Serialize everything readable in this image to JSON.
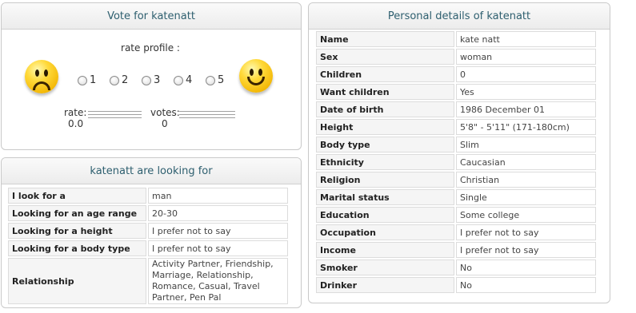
{
  "vote": {
    "title": "Vote for katenatt",
    "rate_profile": "rate profile :",
    "options": [
      "1",
      "2",
      "3",
      "4",
      "5"
    ],
    "rate_label": "rate:",
    "rate_value": "0.0",
    "votes_label": "votes:",
    "votes_value": "0"
  },
  "looking": {
    "title": "katenatt are looking for",
    "rows": [
      {
        "label": "I look for a",
        "value": "man"
      },
      {
        "label": "Looking for an age range",
        "value": "20-30"
      },
      {
        "label": "Looking for a height",
        "value": "I prefer not to say"
      },
      {
        "label": "Looking for a body type",
        "value": "I prefer not to say"
      },
      {
        "label": "Relationship",
        "value": "Activity Partner, Friendship, Marriage, Relationship, Romance, Casual, Travel Partner, Pen Pal"
      }
    ]
  },
  "details": {
    "title": "Personal details of katenatt",
    "rows": [
      {
        "label": "Name",
        "value": "kate natt"
      },
      {
        "label": "Sex",
        "value": "woman"
      },
      {
        "label": "Children",
        "value": "0"
      },
      {
        "label": "Want children",
        "value": "Yes"
      },
      {
        "label": "Date of birth",
        "value": "1986 December 01"
      },
      {
        "label": "Height",
        "value": "5'8\" - 5'11\" (171-180cm)"
      },
      {
        "label": "Body type",
        "value": "Slim"
      },
      {
        "label": "Ethnicity",
        "value": "Caucasian"
      },
      {
        "label": "Religion",
        "value": "Christian"
      },
      {
        "label": "Marital status",
        "value": "Single"
      },
      {
        "label": "Education",
        "value": "Some college"
      },
      {
        "label": "Occupation",
        "value": "I prefer not to say"
      },
      {
        "label": "Income",
        "value": "I prefer not to say"
      },
      {
        "label": "Smoker",
        "value": "No"
      },
      {
        "label": "Drinker",
        "value": "No"
      }
    ]
  },
  "icons": {
    "sad": "sad-face-icon",
    "happy": "happy-face-icon"
  }
}
